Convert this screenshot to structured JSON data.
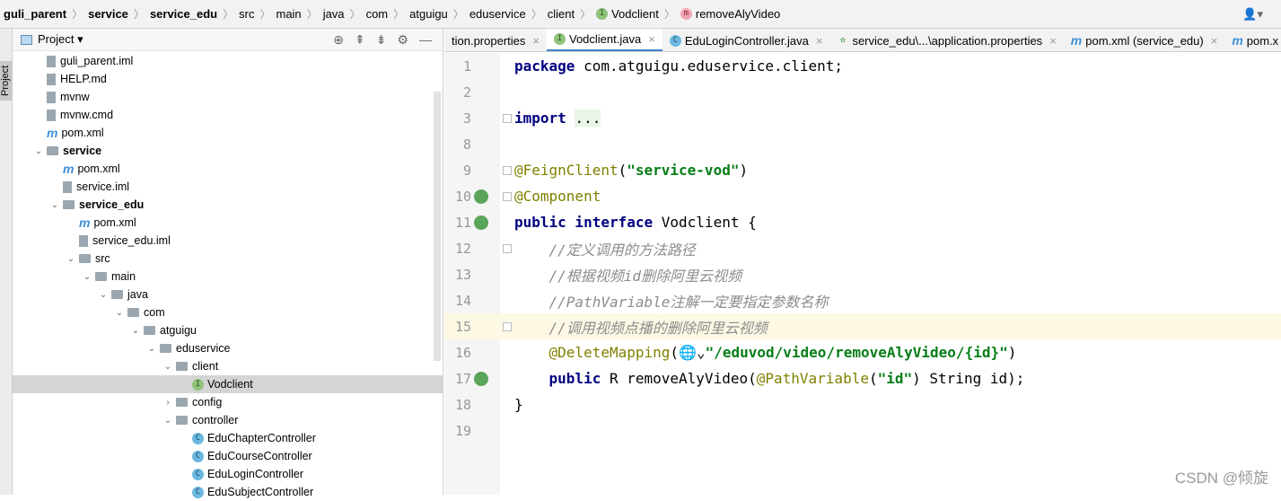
{
  "breadcrumb": [
    {
      "label": "guli_parent",
      "bold": true
    },
    {
      "label": "service",
      "bold": true
    },
    {
      "label": "service_edu",
      "bold": true
    },
    {
      "label": "src"
    },
    {
      "label": "main"
    },
    {
      "label": "java"
    },
    {
      "label": "com"
    },
    {
      "label": "atguigu"
    },
    {
      "label": "eduservice"
    },
    {
      "label": "client"
    },
    {
      "label": "Vodclient",
      "badge": "I"
    },
    {
      "label": "removeAlyVideo",
      "badge": "m"
    }
  ],
  "stripe_label": "Project",
  "project": {
    "title": "Project ▾",
    "tools": [
      "⊕",
      "⇞",
      "⇟",
      "⚙",
      "—"
    ]
  },
  "tree": [
    {
      "label": "guli_parent.iml",
      "level": 1,
      "type": "file"
    },
    {
      "label": "HELP.md",
      "level": 1,
      "type": "file"
    },
    {
      "label": "mvnw",
      "level": 1,
      "type": "file"
    },
    {
      "label": "mvnw.cmd",
      "level": 1,
      "type": "file"
    },
    {
      "label": "pom.xml",
      "level": 1,
      "type": "maven"
    },
    {
      "label": "service",
      "level": 1,
      "type": "folder",
      "open": true,
      "bold": true
    },
    {
      "label": "pom.xml",
      "level": 2,
      "type": "maven"
    },
    {
      "label": "service.iml",
      "level": 2,
      "type": "file"
    },
    {
      "label": "service_edu",
      "level": 2,
      "type": "folder",
      "open": true,
      "bold": true
    },
    {
      "label": "pom.xml",
      "level": 3,
      "type": "maven"
    },
    {
      "label": "service_edu.iml",
      "level": 3,
      "type": "file"
    },
    {
      "label": "src",
      "level": 3,
      "type": "folder",
      "open": true
    },
    {
      "label": "main",
      "level": 4,
      "type": "folder",
      "open": true
    },
    {
      "label": "java",
      "level": 5,
      "type": "folder",
      "open": true
    },
    {
      "label": "com",
      "level": 6,
      "type": "folder",
      "open": true
    },
    {
      "label": "atguigu",
      "level": 7,
      "type": "folder",
      "open": true
    },
    {
      "label": "eduservice",
      "level": 8,
      "type": "folder",
      "open": true
    },
    {
      "label": "client",
      "level": 9,
      "type": "folder",
      "open": true
    },
    {
      "label": "Vodclient",
      "level": 10,
      "type": "interface",
      "selected": true
    },
    {
      "label": "config",
      "level": 9,
      "type": "folder",
      "open": false
    },
    {
      "label": "controller",
      "level": 9,
      "type": "folder",
      "open": true
    },
    {
      "label": "EduChapterController",
      "level": 10,
      "type": "class"
    },
    {
      "label": "EduCourseController",
      "level": 10,
      "type": "class"
    },
    {
      "label": "EduLoginController",
      "level": 10,
      "type": "class"
    },
    {
      "label": "EduSubjectController",
      "level": 10,
      "type": "class"
    }
  ],
  "tabs": [
    {
      "label": "tion.properties",
      "icon": ""
    },
    {
      "label": "Vodclient.java",
      "icon": "I",
      "active": true
    },
    {
      "label": "EduLoginController.java",
      "icon": "C"
    },
    {
      "label": "service_edu\\...\\application.properties",
      "icon": "spring"
    },
    {
      "label": "pom.xml (service_edu)",
      "icon": "m"
    },
    {
      "label": "pom.x",
      "icon": "m"
    }
  ],
  "code": [
    {
      "n": "1",
      "seg": [
        [
          "kw",
          "package "
        ],
        [
          "pl",
          "com.atguigu.eduservice.client;"
        ]
      ]
    },
    {
      "n": "2",
      "seg": []
    },
    {
      "n": "3",
      "fold": true,
      "seg": [
        [
          "kw",
          "import "
        ],
        [
          "fd",
          "..."
        ]
      ]
    },
    {
      "n": "8",
      "seg": []
    },
    {
      "n": "9",
      "fold": true,
      "seg": [
        [
          "an",
          "@FeignClient"
        ],
        [
          "pl",
          "("
        ],
        [
          "st",
          "\"service-vod\""
        ],
        [
          "pl",
          ")"
        ]
      ]
    },
    {
      "n": "10",
      "gutter": "check",
      "fold": true,
      "seg": [
        [
          "an",
          "@Component"
        ]
      ]
    },
    {
      "n": "11",
      "gutter": "globe",
      "seg": [
        [
          "kw",
          "public interface "
        ],
        [
          "pl",
          "Vodclient {"
        ]
      ]
    },
    {
      "n": "12",
      "fold": true,
      "seg": [
        [
          "cm",
          "    //定义调用的方法路径"
        ]
      ]
    },
    {
      "n": "13",
      "seg": [
        [
          "cm",
          "    //根据视频id删除阿里云视频"
        ]
      ]
    },
    {
      "n": "14",
      "seg": [
        [
          "cm",
          "    //PathVariable注解一定要指定参数名称"
        ]
      ]
    },
    {
      "n": "15",
      "highlight": true,
      "fold": true,
      "seg": [
        [
          "cm",
          "    //调用视频点播的删除阿里云视频"
        ]
      ]
    },
    {
      "n": "16",
      "seg": [
        [
          "an",
          "    @DeleteMapping"
        ],
        [
          "pl",
          "(🌐⌄"
        ],
        [
          "st",
          "\"/eduvod/video/removeAlyVideo/{id}\""
        ],
        [
          "pl",
          ")"
        ]
      ]
    },
    {
      "n": "17",
      "gutter": "globe",
      "seg": [
        [
          "kw",
          "    public "
        ],
        [
          "pl",
          "R removeAlyVideo("
        ],
        [
          "an",
          "@PathVariable"
        ],
        [
          "pl",
          "("
        ],
        [
          "st",
          "\"id\""
        ],
        [
          "pl",
          ") String id);"
        ]
      ]
    },
    {
      "n": "18",
      "seg": [
        [
          "pl",
          "}"
        ]
      ]
    },
    {
      "n": "19",
      "seg": []
    }
  ],
  "watermark": "CSDN @倾旋"
}
